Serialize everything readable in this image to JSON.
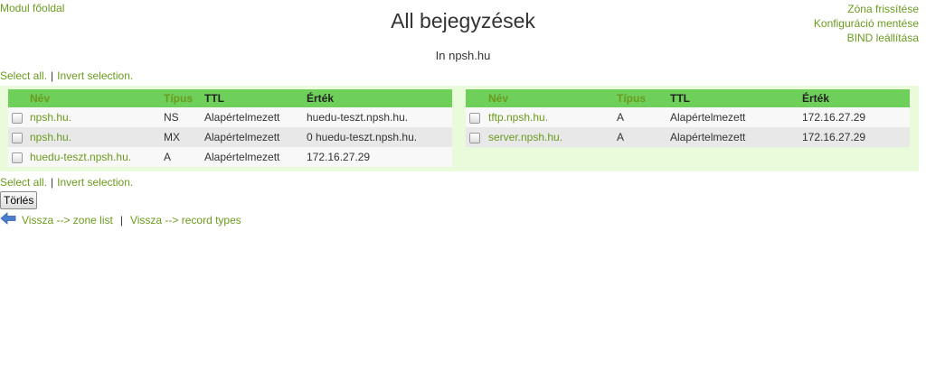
{
  "header": {
    "module_home": "Modul főoldal",
    "title": "All bejegyzések",
    "subtitle": "In npsh.hu",
    "right_links": [
      "Zóna frissítése",
      "Konfiguráció mentése",
      "BIND leállítása"
    ]
  },
  "selection": {
    "select_all": "Select all.",
    "separator": "|",
    "invert": "Invert selection."
  },
  "columns": [
    "Név",
    "Típus",
    "TTL",
    "Érték"
  ],
  "left_table": [
    {
      "name": "npsh.hu.",
      "type": "NS",
      "ttl": "Alapértelmezett",
      "value": "huedu-teszt.npsh.hu."
    },
    {
      "name": "npsh.hu.",
      "type": "MX",
      "ttl": "Alapértelmezett",
      "value": "0 huedu-teszt.npsh.hu."
    },
    {
      "name": "huedu-teszt.npsh.hu.",
      "type": "A",
      "ttl": "Alapértelmezett",
      "value": "172.16.27.29"
    }
  ],
  "right_table": [
    {
      "name": "tftp.npsh.hu.",
      "type": "A",
      "ttl": "Alapértelmezett",
      "value": "172.16.27.29"
    },
    {
      "name": "server.npsh.hu.",
      "type": "A",
      "ttl": "Alapértelmezett",
      "value": "172.16.27.29"
    }
  ],
  "delete_button": "Törlés",
  "back": {
    "icon": "back-arrow-icon",
    "zone_list": "Vissza --> zone list",
    "separator": "|",
    "record_types": "Vissza --> record types"
  },
  "colors": {
    "link": "#6b9a1f",
    "header_bg": "#6fcf5b",
    "panel_bg": "#eafbdc"
  }
}
